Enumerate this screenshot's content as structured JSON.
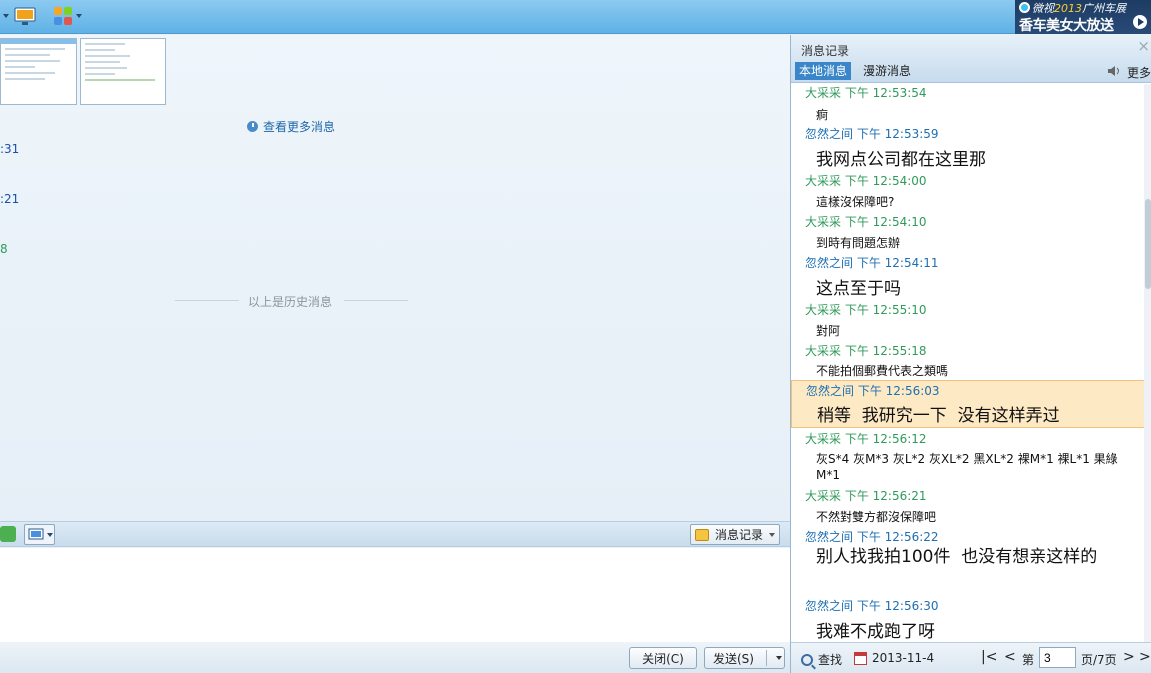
{
  "toolbar": {
    "ad_line1_brand": "微视",
    "ad_line1_year": "2013",
    "ad_line1_rest": "广州车展",
    "ad_line2": "香车美女大放送"
  },
  "chat": {
    "more_messages": "查看更多消息",
    "history_divider": "以上是历史消息",
    "cut_times": [
      ":31",
      ":21",
      "8"
    ],
    "msg_record_button": "消息记录",
    "close_button": "关闭(C)",
    "send_button": "发送(S)"
  },
  "history": {
    "title": "消息记录",
    "tabs": [
      "本地消息",
      "漫游消息"
    ],
    "more": "更多",
    "messages": [
      {
        "sender": "大采采",
        "time": "下午 12:53:54",
        "text": "痾"
      },
      {
        "sender": "忽然之间",
        "time": "下午 12:53:59",
        "text": "我网点公司都在这里那"
      },
      {
        "sender": "大采采",
        "time": "下午 12:54:00",
        "text": "這樣沒保障吧?"
      },
      {
        "sender": "大采采",
        "time": "下午 12:54:10",
        "text": "到時有問題怎辦"
      },
      {
        "sender": "忽然之间",
        "time": "下午 12:54:11",
        "text": "这点至于吗"
      },
      {
        "sender": "大采采",
        "time": "下午 12:55:10",
        "text": "對阿"
      },
      {
        "sender": "大采采",
        "time": "下午 12:55:18",
        "text": "不能拍個郵費代表之類嗎"
      },
      {
        "sender": "忽然之间",
        "time": "下午 12:56:03",
        "text": "稍等  我研究一下  没有这样弄过"
      },
      {
        "sender": "大采采",
        "time": "下午 12:56:12",
        "text": "灰S*4 灰M*3 灰L*2 灰XL*2 黑XL*2 裸M*1 裸L*1 果綠M*1"
      },
      {
        "sender": "大采采",
        "time": "下午 12:56:21",
        "text": "不然對雙方都沒保障吧"
      },
      {
        "sender": "忽然之间",
        "time": "下午 12:56:22",
        "text": "别人找我拍100件  也没有想亲这样的"
      },
      {
        "sender": "忽然之间",
        "time": "下午 12:56:30",
        "text": "我难不成跑了呀"
      }
    ],
    "footer": {
      "search": "查找",
      "date": "2013-11-4",
      "page_prefix": "第",
      "page_value": "3",
      "page_suffix": "页/7页"
    }
  },
  "colors": {
    "sender_other": "#2f9a5a",
    "sender_self": "#1e6fb3",
    "highlight": "#fde9c3"
  }
}
